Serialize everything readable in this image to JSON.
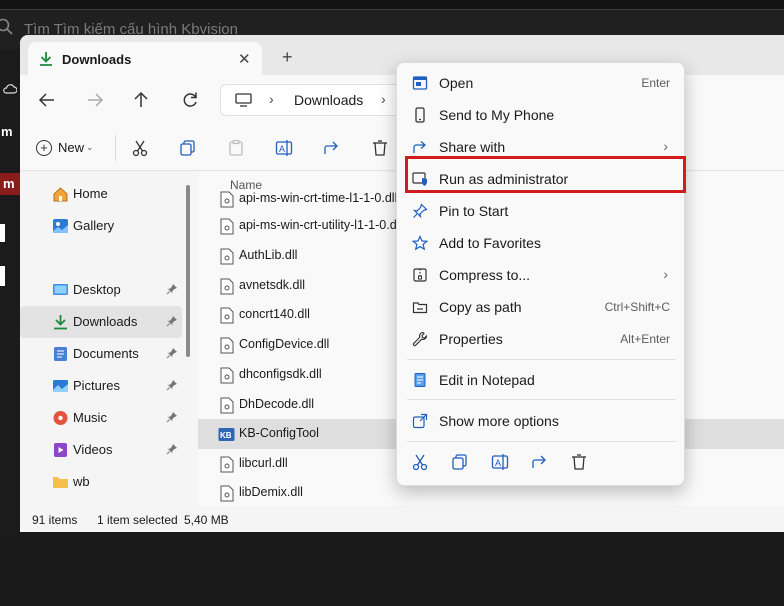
{
  "background": {
    "search_placeholder": "Tìm Tìm kiếm cấu hình Kbvision",
    "side_snippet_1": "m",
    "side_snippet_2": "m"
  },
  "window": {
    "tab_title": "Downloads",
    "tab_close": "✕",
    "new_tab": "+",
    "address": {
      "sep": "›",
      "location": "Downloads"
    }
  },
  "toolbar": {
    "new_label": "New",
    "new_chevron": "⌄",
    "icons": [
      "cut-icon",
      "copy-icon",
      "paste-icon",
      "rename-icon",
      "share-icon",
      "delete-icon"
    ]
  },
  "sidebar": {
    "items": [
      {
        "label": "Home",
        "icon": "home-icon"
      },
      {
        "label": "Gallery",
        "icon": "gallery-icon"
      },
      {
        "label": "Desktop",
        "icon": "desktop-icon",
        "pinned": true
      },
      {
        "label": "Downloads",
        "icon": "downloads-icon",
        "pinned": true,
        "active": true
      },
      {
        "label": "Documents",
        "icon": "documents-icon",
        "pinned": true
      },
      {
        "label": "Pictures",
        "icon": "pictures-icon",
        "pinned": true
      },
      {
        "label": "Music",
        "icon": "music-icon",
        "pinned": true
      },
      {
        "label": "Videos",
        "icon": "videos-icon",
        "pinned": true
      },
      {
        "label": "wb",
        "icon": "folder-icon"
      }
    ]
  },
  "filelist": {
    "column_name": "Name",
    "files": [
      {
        "name": "api-ms-win-crt-time-l1-1-0.dll"
      },
      {
        "name": "api-ms-win-crt-utility-l1-1-0.dll"
      },
      {
        "name": "AuthLib.dll"
      },
      {
        "name": "avnetsdk.dll"
      },
      {
        "name": "concrt140.dll"
      },
      {
        "name": "ConfigDevice.dll"
      },
      {
        "name": "dhconfigsdk.dll"
      },
      {
        "name": "DhDecode.dll"
      },
      {
        "name": "KB-ConfigTool",
        "selected": true,
        "app_badge": "KB"
      },
      {
        "name": "libcurl.dll"
      },
      {
        "name": "libDemix.dll"
      }
    ]
  },
  "statusbar": {
    "count": "91 items",
    "selection": "1 item selected",
    "size": "5,40 MB"
  },
  "context_menu": {
    "items": [
      {
        "label": "Open",
        "shortcut": "Enter",
        "icon": "open-icon"
      },
      {
        "label": "Send to My Phone",
        "shortcut": "",
        "icon": "phone-icon"
      },
      {
        "label": "Share with",
        "shortcut": "",
        "icon": "share-with-icon",
        "submenu": "›"
      },
      {
        "label": "Run as administrator",
        "shortcut": "",
        "icon": "shield-icon",
        "highlighted": true
      },
      {
        "label": "Pin to Start",
        "shortcut": "",
        "icon": "pin-icon"
      },
      {
        "label": "Add to Favorites",
        "shortcut": "",
        "icon": "star-icon"
      },
      {
        "label": "Compress to...",
        "shortcut": "",
        "icon": "zip-icon",
        "submenu": "›"
      },
      {
        "label": "Copy as path",
        "shortcut": "Ctrl+Shift+C",
        "icon": "copy-path-icon"
      },
      {
        "label": "Properties",
        "shortcut": "Alt+Enter",
        "icon": "wrench-icon"
      },
      {
        "label": "Edit in Notepad",
        "shortcut": "",
        "icon": "notepad-icon"
      },
      {
        "label": "Show more options",
        "shortcut": "",
        "icon": "more-options-icon"
      }
    ],
    "action_icons": [
      "cut-icon",
      "copy-icon",
      "rename-icon",
      "share-icon",
      "delete-icon"
    ],
    "highlight_color": "#d01c1c"
  }
}
